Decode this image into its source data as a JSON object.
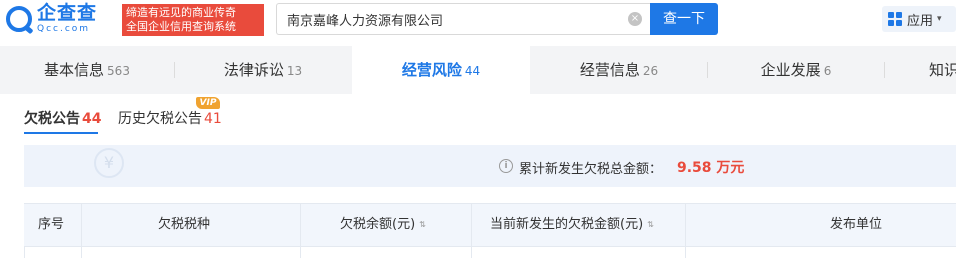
{
  "header": {
    "logo_text": "企查查",
    "logo_sub": "Qcc.com",
    "slogan_line1": "缔造有远见的商业传奇",
    "slogan_line2": "全国企业信用查询系统",
    "search_value": "南京嘉峰人力资源有限公司",
    "search_button": "查一下",
    "apps_label": "应用"
  },
  "tabs": [
    {
      "label": "基本信息",
      "count": "563"
    },
    {
      "label": "法律诉讼",
      "count": "13"
    },
    {
      "label": "经营风险",
      "count": "44"
    },
    {
      "label": "经营信息",
      "count": "26"
    },
    {
      "label": "企业发展",
      "count": "6"
    },
    {
      "label": "知识"
    }
  ],
  "subtabs": [
    {
      "label": "欠税公告",
      "count": "44"
    },
    {
      "label": "历史欠税公告",
      "count": "41"
    }
  ],
  "vip_badge": "VIP",
  "summary": {
    "watermark": "¥",
    "label": "累计新发生欠税总金额：",
    "value": "9.58 万元"
  },
  "table": {
    "columns": [
      "序号",
      "欠税税种",
      "欠税余额(元)",
      "当前新发生的欠税金额(元)",
      "发布单位"
    ]
  },
  "colors": {
    "brand": "#1e78e6",
    "alert": "#e94b3c",
    "vip": "#f0a330"
  },
  "icons": {
    "clear": "×",
    "sort": "⇅",
    "info": "i",
    "caret": "▾"
  }
}
